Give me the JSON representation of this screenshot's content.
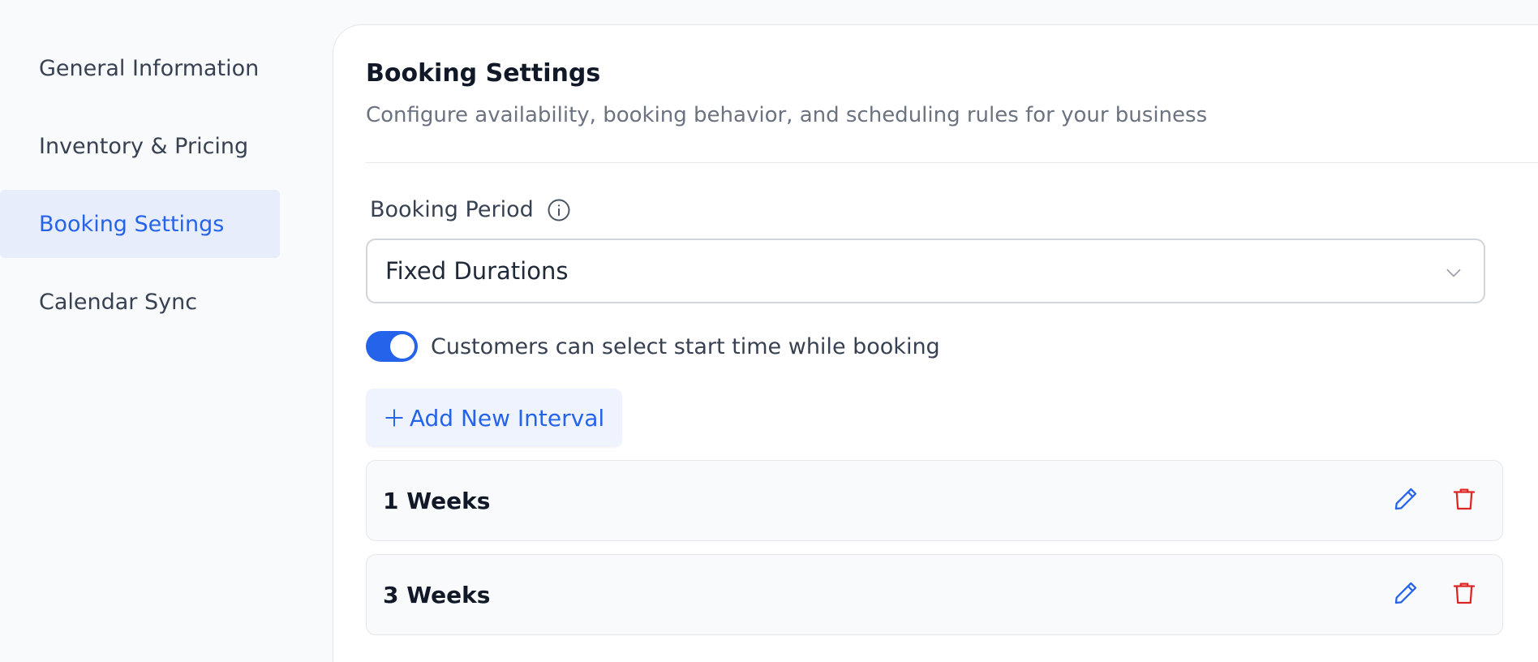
{
  "sidebar": {
    "items": [
      {
        "label": "General Information",
        "active": false
      },
      {
        "label": "Inventory & Pricing",
        "active": false
      },
      {
        "label": "Booking Settings",
        "active": true
      },
      {
        "label": "Calendar Sync",
        "active": false
      }
    ]
  },
  "main": {
    "title": "Booking Settings",
    "subtitle": "Configure availability, booking behavior, and scheduling rules for your business",
    "booking_period": {
      "label": "Booking Period",
      "info_icon": "info-icon",
      "selected": "Fixed Durations"
    },
    "start_time_toggle": {
      "label": "Customers can select start time while booking",
      "enabled": true
    },
    "add_interval": {
      "label": "Add New Interval",
      "icon": "plus-icon"
    },
    "intervals": [
      {
        "label": "1 Weeks"
      },
      {
        "label": "3 Weeks"
      }
    ]
  },
  "colors": {
    "accent": "#2563eb",
    "danger": "#dc2626",
    "active_nav_bg": "#e8edfb"
  }
}
